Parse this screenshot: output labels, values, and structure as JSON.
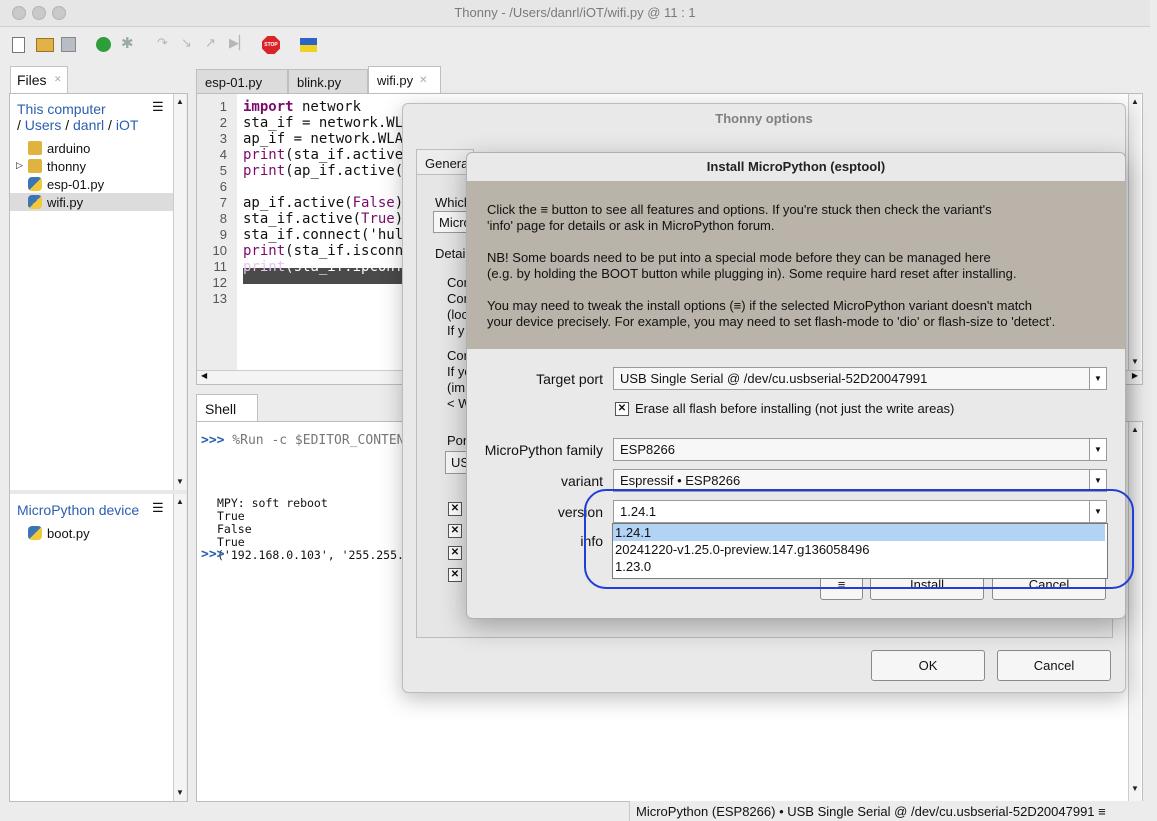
{
  "window": {
    "title": "Thonny  -  /Users/danrl/iOT/wifi.py  @  11 : 1"
  },
  "files": {
    "tab_label": "Files",
    "this_computer": "This computer",
    "breadcrumb": [
      "/ ",
      "Users",
      " / ",
      "danrl",
      " / ",
      "iOT"
    ],
    "items": [
      "arduino",
      "thonny",
      "esp-01.py",
      "wifi.py"
    ],
    "device_title": "MicroPython device",
    "device_items": [
      "boot.py"
    ]
  },
  "editor": {
    "tabs": [
      "esp-01.py",
      "blink.py",
      "wifi.py"
    ],
    "line_numbers": [
      "1",
      "2",
      "3",
      "4",
      "5",
      "6",
      "7",
      "8",
      "9",
      "10",
      "11",
      "12",
      "13"
    ],
    "lines": [
      {
        "pre": "",
        "kw": "import",
        "post": " network"
      },
      {
        "pre": "sta_if = network.WLAN",
        "kw": "",
        "post": ""
      },
      {
        "pre": "ap_if = network.WLAN",
        "kw": "",
        "post": ""
      },
      {
        "pre": "",
        "kw": "print",
        "post": "(sta_if.active("
      },
      {
        "pre": "",
        "kw": "print",
        "post": "(ap_if.active()"
      },
      {
        "pre": "",
        "kw": "",
        "post": ""
      },
      {
        "pre": "ap_if.active(",
        "kw": "False",
        "post": ")"
      },
      {
        "pre": "sta_if.active(",
        "kw": "True",
        "post": ")"
      },
      {
        "pre": "sta_if.connect('hulu",
        "kw": "",
        "post": ""
      },
      {
        "pre": "",
        "kw": "print",
        "post": "(sta_if.isconne"
      },
      {
        "pre": "",
        "kw": "print",
        "post": "(sta_if.ipconfi"
      },
      {
        "pre": "",
        "kw": "",
        "post": ""
      },
      {
        "pre": "",
        "kw": "",
        "post": ""
      }
    ]
  },
  "shell": {
    "tab_label": "Shell",
    "prompt": ">>>",
    "command": " %Run -c $EDITOR_CONTEN",
    "output": [
      "MPY: soft reboot",
      "True",
      "False",
      "True",
      "('192.168.0.103', '255.255."
    ]
  },
  "status_bar": "MicroPython (ESP8266)  •  USB Single Serial @ /dev/cu.usbserial-52D20047991  ≡",
  "options_dialog": {
    "title": "Thonny options",
    "tab_general": "Genera",
    "fragments": [
      "Whicl",
      "Micro",
      "Detai",
      "Cor",
      "Cor",
      "(loc",
      "If y",
      "Cor",
      "If yo",
      "(im",
      "< W",
      "Por",
      "US"
    ],
    "ok_label": "OK",
    "cancel_label": "Cancel"
  },
  "install_dialog": {
    "title": "Install MicroPython (esptool)",
    "info_paragraphs": [
      [
        "Click the ≡ button to see all features and options. If you're stuck then check the variant's",
        "'info' page for details or ask in MicroPython forum."
      ],
      [
        "NB! Some boards need to be put into a special mode before they can be managed here",
        "(e.g. by holding the BOOT button while plugging in). Some require hard reset after installing."
      ],
      [
        "You may need to tweak the install options (≡) if the selected MicroPython variant doesn't match",
        "your device precisely. For example, you may need to set flash-mode to 'dio' or flash-size to 'detect'."
      ]
    ],
    "target_port_label": "Target port",
    "target_port_value": "USB Single Serial @ /dev/cu.usbserial-52D20047991",
    "erase_label": "Erase all flash before installing (not just the write areas)",
    "erase_checked": true,
    "family_label": "MicroPython family",
    "family_value": "ESP8266",
    "variant_label": "variant",
    "variant_value": "Espressif • ESP8266",
    "version_label": "version",
    "version_value": "1.24.1",
    "info_label": "info",
    "menu_label": "≡",
    "install_label": "Install",
    "cancel_label": "Cancel",
    "version_options": [
      "1.24.1",
      "20241220-v1.25.0-preview.147.g136058496",
      "1.23.0"
    ],
    "selected_option": "1.24.1"
  },
  "colors": {
    "highlight_ring": "#1f3fd6",
    "selection": "#b3d3f5",
    "keyword": "#7a0b6b",
    "link": "#2a5fb0"
  }
}
